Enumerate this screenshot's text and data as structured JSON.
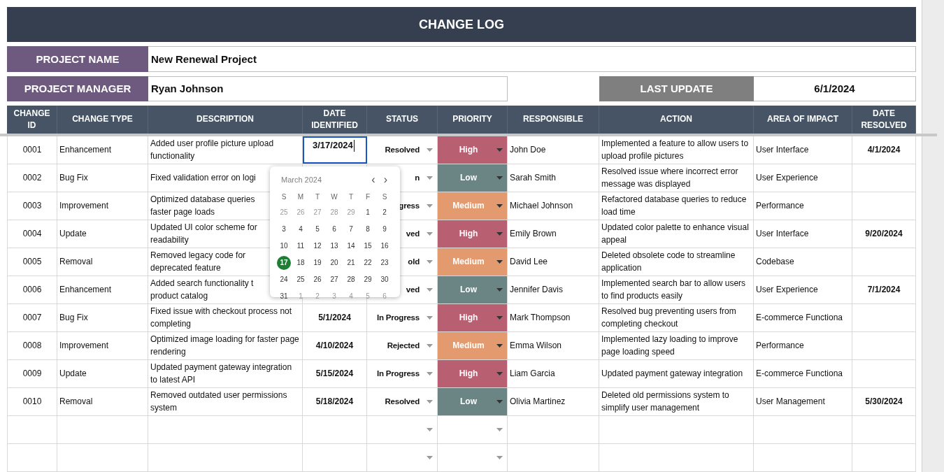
{
  "title": "CHANGE LOG",
  "project_name": {
    "label": "PROJECT NAME",
    "value": "New Renewal Project"
  },
  "project_manager": {
    "label": "PROJECT MANAGER",
    "value": "Ryan Johnson"
  },
  "last_update": {
    "label": "LAST UPDATE",
    "value": "6/1/2024"
  },
  "columns": [
    "CHANGE ID",
    "CHANGE TYPE",
    "DESCRIPTION",
    "DATE IDENTIFIED",
    "STATUS",
    "PRIORITY",
    "RESPONSIBLE",
    "ACTION",
    "AREA OF IMPACT",
    "DATE RESOLVED"
  ],
  "rows": [
    {
      "kind": "entry",
      "id": "0001",
      "type": "Enhancement",
      "description": "Added user profile picture upload functionality",
      "date_identified": "3/17/2024",
      "editing": true,
      "status": "Resolved",
      "priority": "High",
      "color": "#b85f72",
      "responsible": "John Doe",
      "action": "Implemented a feature to allow users to upload profile pictures",
      "area": "User Interface",
      "date_resolved": "4/1/2024"
    },
    {
      "kind": "entry",
      "id": "0002",
      "type": "Bug Fix",
      "description": "Fixed validation error on logi",
      "status": "n",
      "priority": "Low",
      "color": "#6b8585",
      "responsible": "Sarah Smith",
      "action": "Resolved issue where incorrect error message was displayed",
      "area": "User Experience"
    },
    {
      "kind": "entry",
      "id": "0003",
      "type": "Improvement",
      "description": "Optimized database queries\nfaster page loads",
      "status": "gress",
      "priority": "Medium",
      "color": "#e29a6e",
      "responsible": "Michael Johnson",
      "action": "Refactored database queries to reduce load time",
      "area": "Performance"
    },
    {
      "kind": "entry",
      "id": "0004",
      "type": "Update",
      "description": "Updated UI color scheme for\nreadability",
      "status": "ved",
      "priority": "High",
      "color": "#b85f72",
      "responsible": "Emily Brown",
      "action": "Updated color palette to enhance visual appeal",
      "area": "User Interface",
      "date_resolved": "9/20/2024"
    },
    {
      "kind": "entry",
      "id": "0005",
      "type": "Removal",
      "description": "Removed legacy code for\ndeprecated feature",
      "status": "old",
      "priority": "Medium",
      "color": "#e29a6e",
      "responsible": "David Lee",
      "action": "Deleted obsolete code to streamline application",
      "area": "Codebase"
    },
    {
      "kind": "entry",
      "id": "0006",
      "type": "Enhancement",
      "description": "Added search functionality t\nproduct catalog",
      "status": "ved",
      "priority": "Low",
      "color": "#6b8585",
      "responsible": "Jennifer Davis",
      "action": "Implemented search bar to allow users to find products easily",
      "area": "User Experience",
      "date_resolved": "7/1/2024"
    },
    {
      "kind": "entry",
      "id": "0007",
      "type": "Bug Fix",
      "description": "Fixed issue with checkout process not completing",
      "date_identified": "5/1/2024",
      "editing": false,
      "status": "In Progress",
      "priority": "High",
      "color": "#b85f72",
      "responsible": "Mark Thompson",
      "action": "Resolved bug preventing users from completing checkout",
      "area": "E-commerce Functiona"
    },
    {
      "kind": "entry",
      "id": "0008",
      "type": "Improvement",
      "description": "Optimized image loading for faster page rendering",
      "date_identified": "4/10/2024",
      "editing": false,
      "status": "Rejected",
      "priority": "Medium",
      "color": "#e29a6e",
      "responsible": "Emma Wilson",
      "action": "Implemented lazy loading to improve page loading speed",
      "area": "Performance"
    },
    {
      "kind": "entry",
      "id": "0009",
      "type": "Update",
      "description": "Updated payment gateway integration to latest API",
      "date_identified": "5/15/2024",
      "editing": false,
      "status": "In Progress",
      "priority": "High",
      "color": "#b85f72",
      "responsible": "Liam Garcia",
      "action": "Updated payment gateway integration",
      "area": "E-commerce Functiona"
    },
    {
      "kind": "entry",
      "id": "0010",
      "type": "Removal",
      "description": "Removed outdated user permissions system",
      "date_identified": "5/18/2024",
      "editing": false,
      "status": "Resolved",
      "priority": "Low",
      "color": "#6b8585",
      "responsible": "Olivia Martinez",
      "action": "Deleted old permissions system to simplify user management",
      "area": "User Management",
      "date_resolved": "5/30/2024"
    },
    {
      "kind": "blank"
    },
    {
      "kind": "blank"
    }
  ],
  "calendar": {
    "month": "March 2024",
    "prev": "‹",
    "next": "›",
    "weekdays": [
      "S",
      "M",
      "T",
      "W",
      "T",
      "F",
      "S"
    ],
    "weeks": [
      [
        {
          "d": "25",
          "muted": true,
          "selected": false
        },
        {
          "d": "26",
          "muted": true,
          "selected": false
        },
        {
          "d": "27",
          "muted": true,
          "selected": false
        },
        {
          "d": "28",
          "muted": true,
          "selected": false
        },
        {
          "d": "29",
          "muted": true,
          "selected": false
        },
        {
          "d": "1",
          "muted": false,
          "selected": false
        },
        {
          "d": "2",
          "muted": false,
          "selected": false
        }
      ],
      [
        {
          "d": "3",
          "muted": false,
          "selected": false
        },
        {
          "d": "4",
          "muted": false,
          "selected": false
        },
        {
          "d": "5",
          "muted": false,
          "selected": false
        },
        {
          "d": "6",
          "muted": false,
          "selected": false
        },
        {
          "d": "7",
          "muted": false,
          "selected": false
        },
        {
          "d": "8",
          "muted": false,
          "selected": false
        },
        {
          "d": "9",
          "muted": false,
          "selected": false
        }
      ],
      [
        {
          "d": "10",
          "muted": false,
          "selected": false
        },
        {
          "d": "11",
          "muted": false,
          "selected": false
        },
        {
          "d": "12",
          "muted": false,
          "selected": false
        },
        {
          "d": "13",
          "muted": false,
          "selected": false
        },
        {
          "d": "14",
          "muted": false,
          "selected": false
        },
        {
          "d": "15",
          "muted": false,
          "selected": false
        },
        {
          "d": "16",
          "muted": false,
          "selected": false
        }
      ],
      [
        {
          "d": "17",
          "muted": false,
          "selected": true
        },
        {
          "d": "18",
          "muted": false,
          "selected": false
        },
        {
          "d": "19",
          "muted": false,
          "selected": false
        },
        {
          "d": "20",
          "muted": false,
          "selected": false
        },
        {
          "d": "21",
          "muted": false,
          "selected": false
        },
        {
          "d": "22",
          "muted": false,
          "selected": false
        },
        {
          "d": "23",
          "muted": false,
          "selected": false
        }
      ],
      [
        {
          "d": "24",
          "muted": false,
          "selected": false
        },
        {
          "d": "25",
          "muted": false,
          "selected": false
        },
        {
          "d": "26",
          "muted": false,
          "selected": false
        },
        {
          "d": "27",
          "muted": false,
          "selected": false
        },
        {
          "d": "28",
          "muted": false,
          "selected": false
        },
        {
          "d": "29",
          "muted": false,
          "selected": false
        },
        {
          "d": "30",
          "muted": false,
          "selected": false
        }
      ],
      [
        {
          "d": "31",
          "muted": false,
          "selected": false
        },
        {
          "d": "1",
          "muted": true,
          "selected": false
        },
        {
          "d": "2",
          "muted": true,
          "selected": false
        },
        {
          "d": "3",
          "muted": true,
          "selected": false
        },
        {
          "d": "4",
          "muted": true,
          "selected": false
        },
        {
          "d": "5",
          "muted": true,
          "selected": false
        },
        {
          "d": "6",
          "muted": true,
          "selected": false
        }
      ]
    ]
  }
}
